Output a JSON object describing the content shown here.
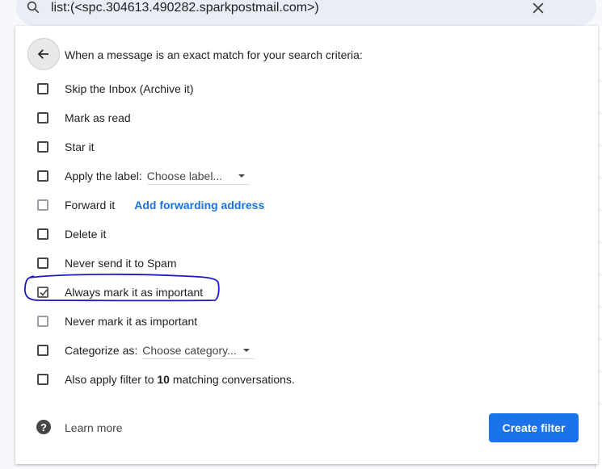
{
  "search": {
    "query": "list:(<spc.304613.490282.sparkpostmail.com>)",
    "icon": "search-icon",
    "clear_icon": "close-icon"
  },
  "filter": {
    "back_icon": "arrow-left-icon",
    "header": "When a message is an exact match for your search criteria:",
    "options": [
      {
        "label": "Skip the Inbox (Archive it)",
        "checked": false
      },
      {
        "label": "Mark as read",
        "checked": false
      },
      {
        "label": "Star it",
        "checked": false
      },
      {
        "label": "Apply the label:",
        "checked": false,
        "select": "Choose label..."
      },
      {
        "label": "Forward it",
        "checked": false,
        "disabled": true,
        "link": "Add forwarding address"
      },
      {
        "label": "Delete it",
        "checked": false
      },
      {
        "label": "Never send it to Spam",
        "checked": false
      },
      {
        "label": "Always mark it as important",
        "checked": true
      },
      {
        "label": "Never mark it as important",
        "checked": false,
        "disabled": true
      },
      {
        "label": "Categorize as:",
        "checked": false,
        "select": "Choose category..."
      },
      {
        "label_pre": "Also apply filter to ",
        "count": "10",
        "label_post": " matching conversations.",
        "checked": false
      }
    ],
    "learn_more": "Learn more",
    "create_button": "Create filter"
  },
  "colors": {
    "accent": "#1a73e8",
    "annotation": "#1a1acc"
  }
}
